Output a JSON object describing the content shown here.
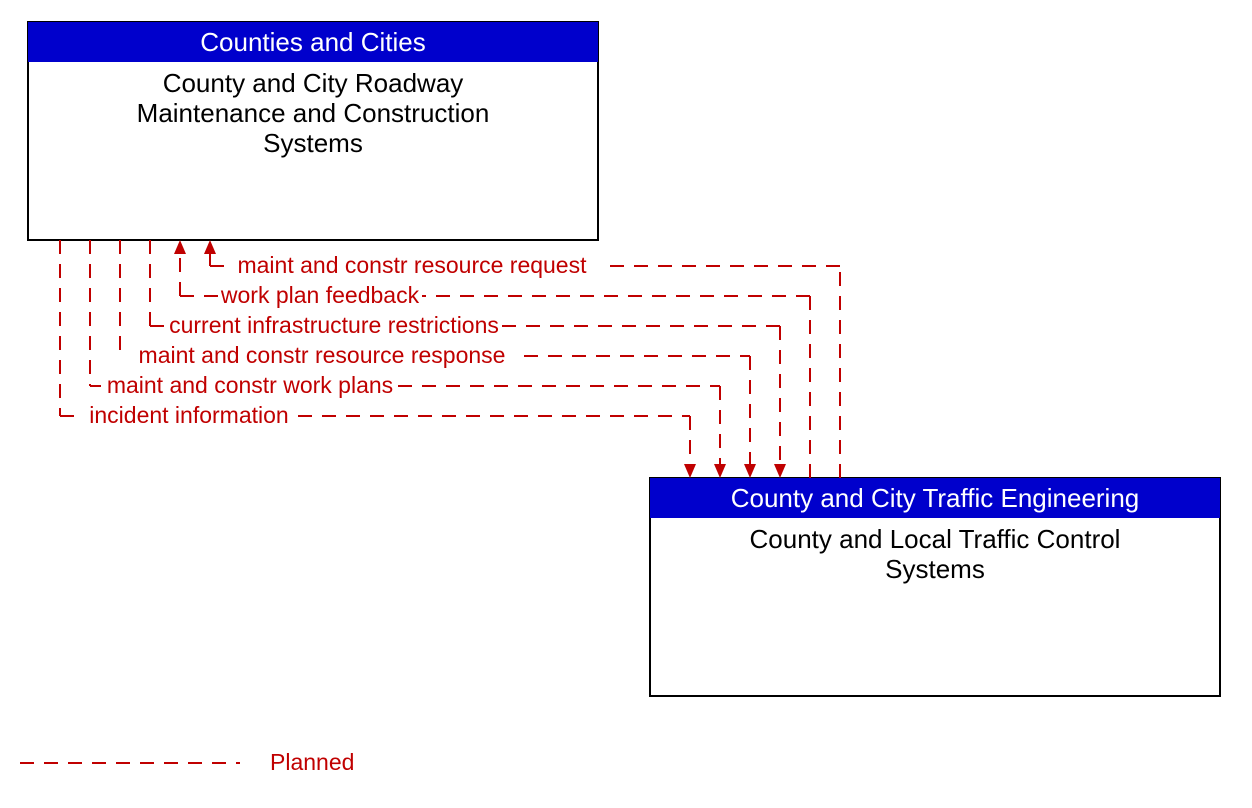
{
  "boxA": {
    "header": "Counties and Cities",
    "body_line1": "County and City Roadway",
    "body_line2": "Maintenance and Construction",
    "body_line3": "Systems"
  },
  "boxB": {
    "header": "County and City Traffic Engineering",
    "body_line1": "County and Local Traffic Control",
    "body_line2": "Systems"
  },
  "flows": {
    "f1": "maint and constr resource request",
    "f2": "work plan feedback",
    "f3": "current infrastructure restrictions",
    "f4": "maint and constr resource response",
    "f5": "maint and constr work plans",
    "f6": "incident information"
  },
  "legend": {
    "planned": "Planned"
  },
  "colors": {
    "header_bg": "#0000cc",
    "flow": "#c00000"
  }
}
